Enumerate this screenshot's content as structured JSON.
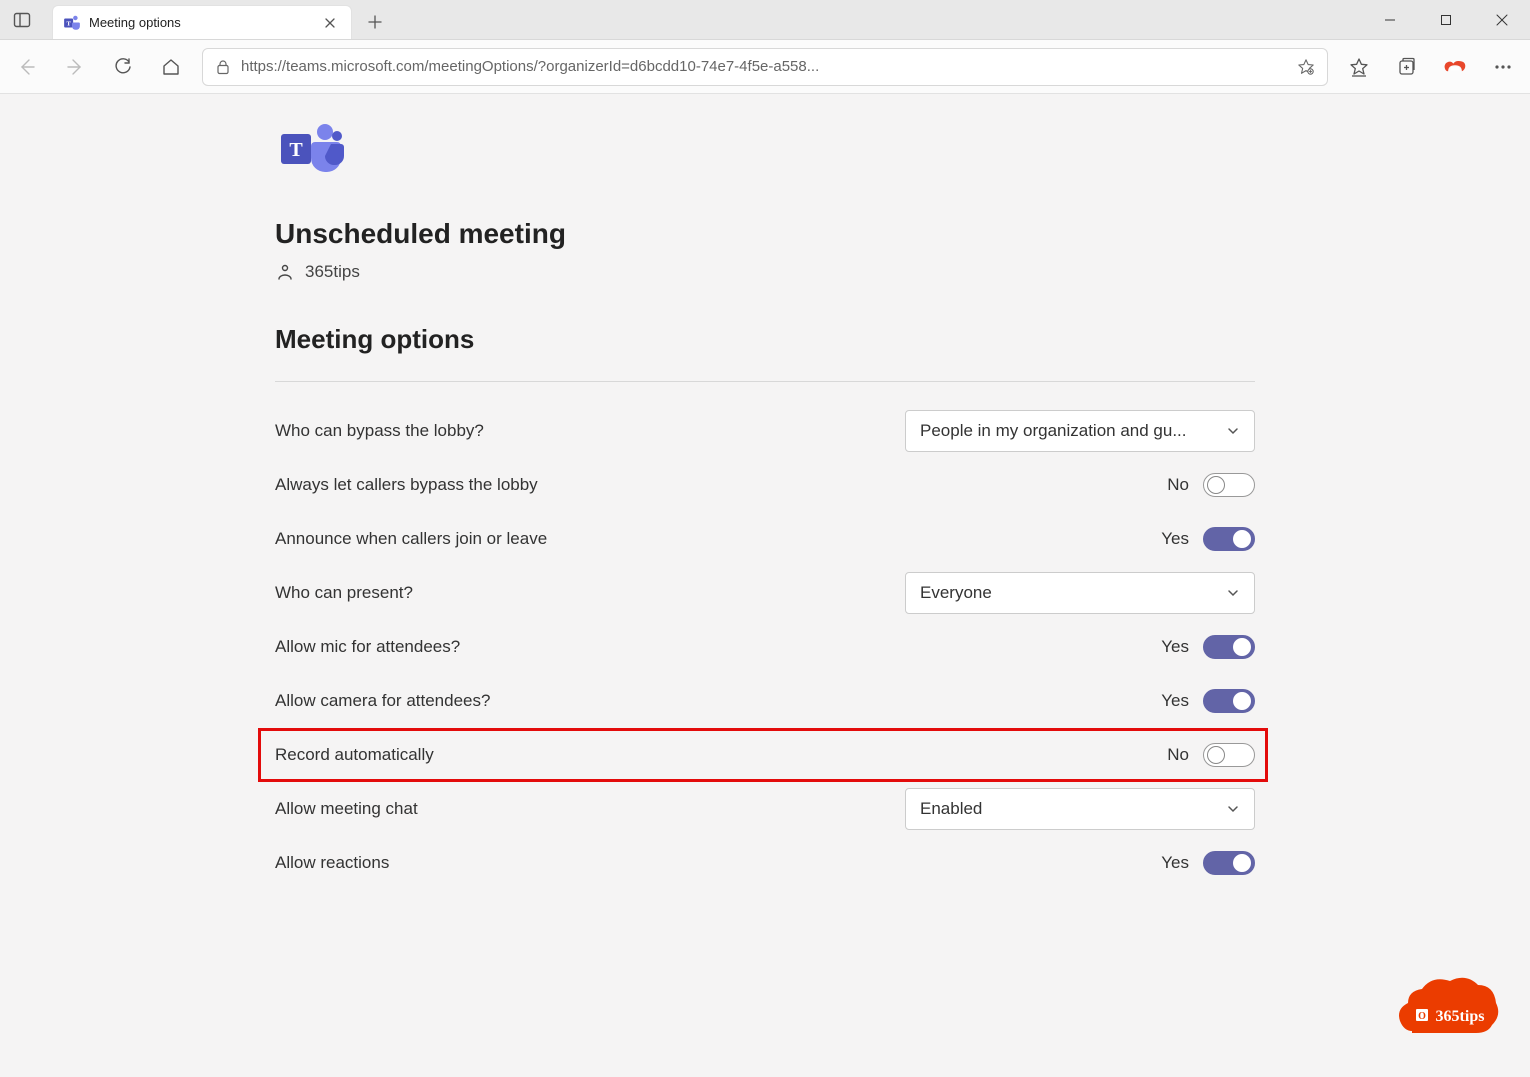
{
  "window": {
    "tab_title": "Meeting options",
    "url_display": "https://teams.microsoft.com/meetingOptions/?organizerId=d6bcdd10-74e7-4f5e-a558..."
  },
  "page": {
    "title": "Unscheduled meeting",
    "organizer": "365tips",
    "section_title": "Meeting options"
  },
  "options": {
    "bypass_lobby": {
      "label": "Who can bypass the lobby?",
      "value": "People in my organization and gu..."
    },
    "callers_bypass": {
      "label": "Always let callers bypass the lobby",
      "state_text": "No"
    },
    "announce_callers": {
      "label": "Announce when callers join or leave",
      "state_text": "Yes"
    },
    "who_present": {
      "label": "Who can present?",
      "value": "Everyone"
    },
    "allow_mic": {
      "label": "Allow mic for attendees?",
      "state_text": "Yes"
    },
    "allow_camera": {
      "label": "Allow camera for attendees?",
      "state_text": "Yes"
    },
    "record_auto": {
      "label": "Record automatically",
      "state_text": "No"
    },
    "allow_chat": {
      "label": "Allow meeting chat",
      "value": "Enabled"
    },
    "allow_reactions": {
      "label": "Allow reactions",
      "state_text": "Yes"
    }
  },
  "badge": {
    "text": "365tips"
  }
}
